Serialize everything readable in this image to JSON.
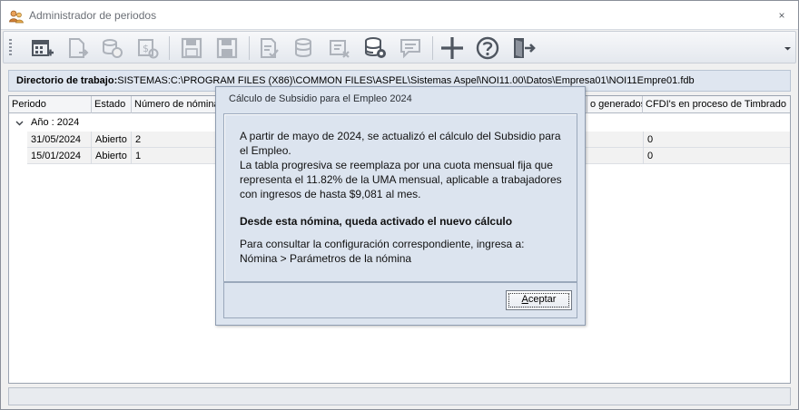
{
  "window": {
    "title": "Administrador de periodos",
    "close_glyph": "×"
  },
  "toolbar": {
    "buttons": [
      {
        "icon": "calendar-add-icon",
        "enabled": true
      },
      {
        "icon": "document-export-icon",
        "enabled": false
      },
      {
        "icon": "coins-refresh-icon",
        "enabled": false
      },
      {
        "icon": "calculate-payroll-icon",
        "enabled": false
      },
      {
        "icon": "save-icon",
        "enabled": false
      },
      {
        "icon": "save-as-icon",
        "enabled": false
      },
      {
        "icon": "document-check-icon",
        "enabled": false
      },
      {
        "icon": "database-check-icon",
        "enabled": false
      },
      {
        "icon": "cancel-stamp-icon",
        "enabled": false
      },
      {
        "icon": "database-settings-icon",
        "enabled": true
      },
      {
        "icon": "comment-icon",
        "enabled": false
      },
      {
        "icon": "plus-icon",
        "enabled": true
      },
      {
        "icon": "help-icon",
        "enabled": true
      },
      {
        "icon": "exit-icon",
        "enabled": true
      }
    ]
  },
  "directory": {
    "label": "Directorio de trabajo:",
    "value": "SISTEMAS:C:\\PROGRAM FILES (X86)\\COMMON FILES\\ASPEL\\Sistemas Aspel\\NOI11.00\\Datos\\Empresa01\\NOI11Empre01.fdb"
  },
  "grid": {
    "columns": [
      "Periodo",
      "Estado",
      "Número de nómina",
      "o generados",
      "CFDI's en proceso de Timbrado"
    ],
    "group_label": "Año : 2024",
    "rows": [
      {
        "periodo": "31/05/2024",
        "estado": "Abierto",
        "numero": "2",
        "cfdi": "0"
      },
      {
        "periodo": "15/01/2024",
        "estado": "Abierto",
        "numero": "1",
        "cfdi": "0"
      }
    ]
  },
  "dialog": {
    "title": "Cálculo de Subsidio para el Empleo 2024",
    "paragraph1": "A partir de mayo de 2024, se actualizó el cálculo del Subsidio para el Empleo.",
    "paragraph2": "La tabla progresiva se reemplaza por una cuota mensual fija que representa el 11.82% de la UMA mensual, aplicable a trabajadores con ingresos de hasta $9,081 al mes.",
    "heading": "Desde esta nómina, queda activado el nuevo cálculo",
    "paragraph3": "Para consultar  la configuración correspondiente, ingresa a:",
    "path": "Nómina > Parámetros de la nómina",
    "accept_accel": "A",
    "accept_rest": "ceptar"
  },
  "colors": {
    "enabled_icon": "#4f5660",
    "disabled_icon": "#aeb3bb",
    "accent": "#2b5aa8"
  }
}
